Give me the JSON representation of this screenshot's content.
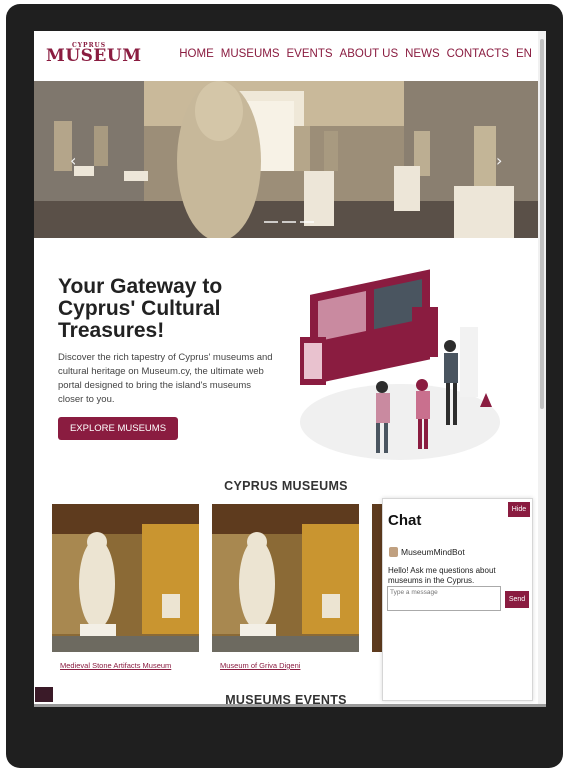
{
  "header": {
    "logo_small": "CYPRUS",
    "logo_big": "MUSEUM",
    "nav": [
      "HOME",
      "MUSEUMS",
      "EVENTS",
      "ABOUT US",
      "NEWS",
      "CONTACTS",
      "EN"
    ]
  },
  "hero": {
    "prev_arrow": "‹",
    "next_arrow": "›"
  },
  "intro": {
    "title": "Your Gateway to Cyprus' Cultural Treasures!",
    "text": "Discover the rich tapestry of Cyprus' museums and cultural heritage on Museum.cy, the ultimate web portal designed to bring the island's museums closer to you.",
    "button": "EXPLORE MUSEUMS"
  },
  "museums": {
    "title": "CYPRUS MUSEUMS",
    "cards": [
      {
        "name": "Medieval Stone Artifacts Museum"
      },
      {
        "name": "Museum of Griva Digeni"
      }
    ]
  },
  "events": {
    "title": "MUSEUMS EVENTS"
  },
  "chat": {
    "title": "Chat",
    "hide_label": "Hide",
    "bot_name": "MuseumMindBot",
    "message": "Hello! Ask me questions about museums in the Cyprus.",
    "input_placeholder": "Type a message",
    "send_label": "Send"
  },
  "colors": {
    "brand": "#8a1c40",
    "frame": "#1f1f1f"
  }
}
